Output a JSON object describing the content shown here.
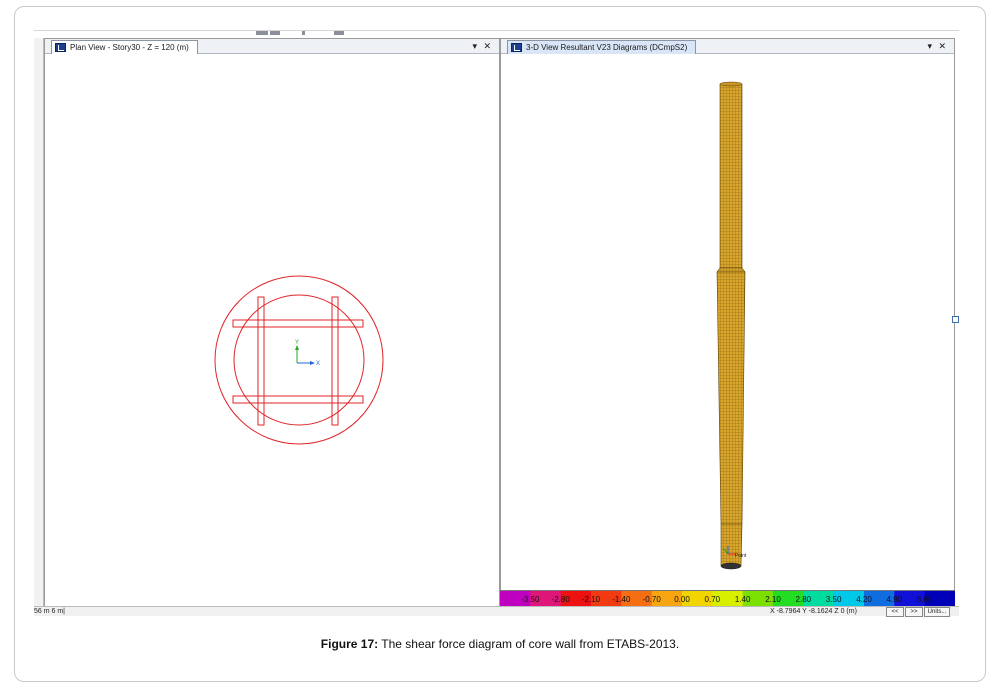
{
  "left_pane": {
    "title": "Plan View - Story30 - Z = 120 (m)",
    "controls": "▾ ✕",
    "axis_x": "X",
    "axis_y": "Y"
  },
  "right_pane": {
    "title": "3-D View   Resultant V23 Diagrams   (DCmpS2)",
    "controls": "▾ ✕",
    "point_label": "Point"
  },
  "legend": {
    "values": [
      "-3.50",
      "-2.80",
      "-2.10",
      "-1.40",
      "-0.70",
      "0.00",
      "0.70",
      "1.40",
      "2.10",
      "2.80",
      "3.50",
      "4.20",
      "4.90",
      "5.60"
    ],
    "colors": [
      "#c000c0",
      "#e0157a",
      "#ee1111",
      "#f23a12",
      "#f56f12",
      "#f7a510",
      "#f2d400",
      "#d8f000",
      "#7be000",
      "#22dd22",
      "#00dca0",
      "#00c8e8",
      "#0f6de0",
      "#1010d8",
      "#0000b8"
    ]
  },
  "status": {
    "left_text": "56 m  6 m|",
    "coords": "X -8.7964  Y -8.1624  Z 0 (m)",
    "prev_label": "<<",
    "next_label": ">>",
    "units_label": "Units..."
  },
  "colors": {
    "plan_lines": "#e0262a",
    "mesh_fill": "#d9a52a",
    "mesh_line": "#7a5a12"
  },
  "caption": {
    "label": "Figure 17:",
    "text": " The shear force diagram of core wall from ETABS-2013."
  }
}
